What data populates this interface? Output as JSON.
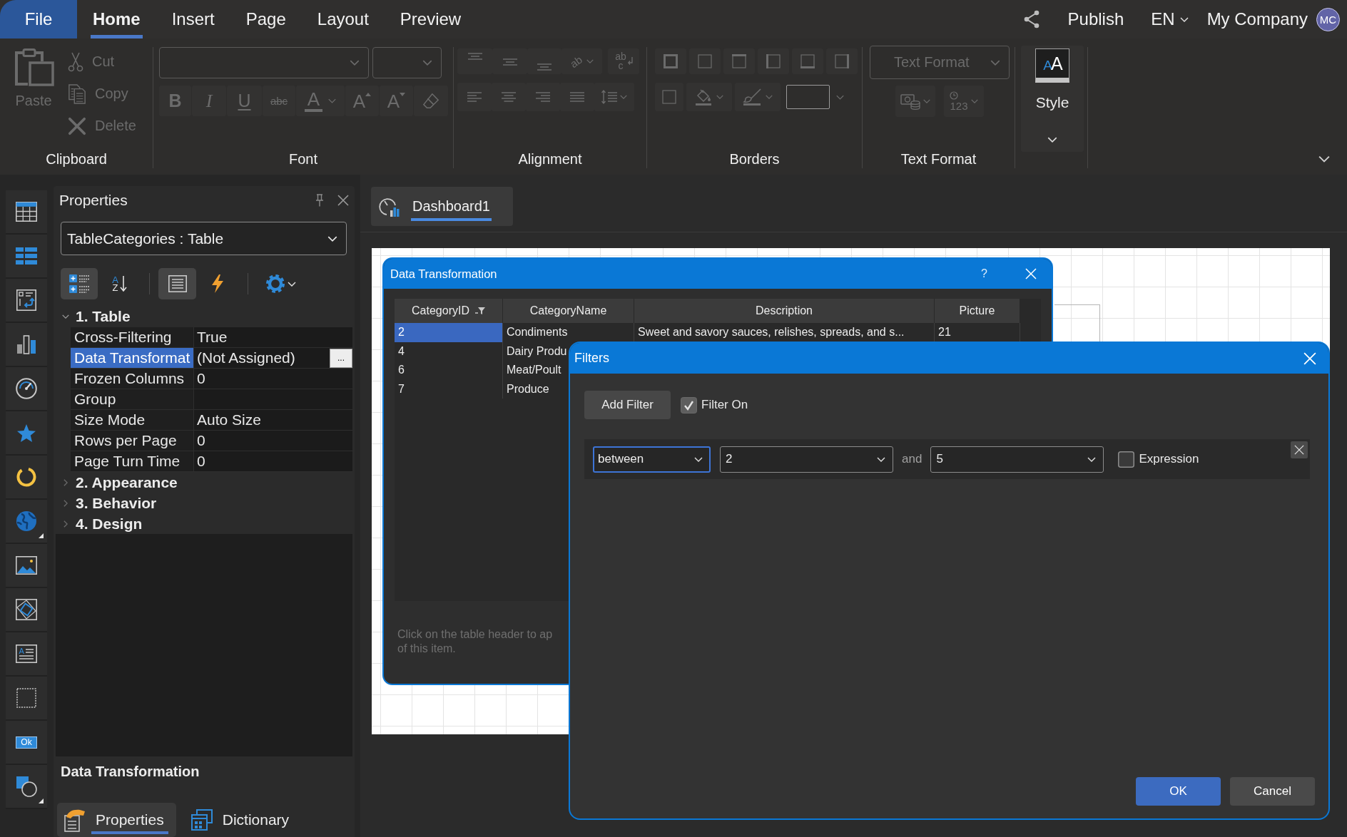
{
  "menu_bar": {
    "tabs": [
      {
        "label": "File",
        "kind": "backstage",
        "selected": false
      },
      {
        "label": "Home",
        "kind": "ribbon",
        "selected": true
      },
      {
        "label": "Insert",
        "kind": "ribbon",
        "selected": false
      },
      {
        "label": "Page",
        "kind": "ribbon",
        "selected": false
      },
      {
        "label": "Layout",
        "kind": "ribbon",
        "selected": false
      },
      {
        "label": "Preview",
        "kind": "ribbon",
        "selected": false
      }
    ],
    "publish": "Publish",
    "language": "EN",
    "account": "My Company",
    "avatar": "MC"
  },
  "ribbon": {
    "groups": [
      {
        "kind": "clipboard",
        "label": "Clipboard",
        "disabled": true,
        "paste": "Paste",
        "actions": [
          {
            "kind": "cut",
            "label": "Cut"
          },
          {
            "kind": "copy",
            "label": "Copy"
          },
          {
            "kind": "delete",
            "label": "Delete"
          }
        ]
      },
      {
        "kind": "font",
        "label": "Font",
        "disabled": true,
        "buttons": [
          {
            "kind": "bold",
            "glyph": "B"
          },
          {
            "kind": "italic",
            "glyph": "I"
          },
          {
            "kind": "underline",
            "glyph": "U"
          },
          {
            "kind": "strikeout",
            "glyph": "abc"
          },
          {
            "kind": "color",
            "glyph": "A"
          },
          {
            "kind": "grow",
            "glyph": "A"
          },
          {
            "kind": "shrink",
            "glyph": "A"
          },
          {
            "kind": "clear"
          }
        ]
      },
      {
        "kind": "alignment",
        "label": "Alignment",
        "disabled": true,
        "rotate_glyph": "ab",
        "wrap_glyph": "ab c"
      },
      {
        "kind": "borders",
        "label": "Borders",
        "disabled": true
      },
      {
        "kind": "text_format",
        "label": "Text Format",
        "disabled": true,
        "format_field": "Text Format",
        "number_glyph": "123"
      },
      {
        "kind": "style",
        "disabled": false,
        "button": "Style",
        "glyph": "AA"
      }
    ]
  },
  "components": [
    {
      "kind": "table",
      "submenu": false
    },
    {
      "kind": "cards",
      "submenu": false
    },
    {
      "kind": "pivot",
      "submenu": false
    },
    {
      "kind": "chart",
      "submenu": false
    },
    {
      "kind": "gauge",
      "submenu": false
    },
    {
      "kind": "indicator",
      "submenu": false
    },
    {
      "kind": "progress",
      "submenu": false
    },
    {
      "kind": "map",
      "submenu": true
    },
    {
      "kind": "image",
      "submenu": false
    },
    {
      "kind": "shape",
      "submenu": false
    },
    {
      "kind": "text",
      "glyph": "A",
      "submenu": false
    },
    {
      "kind": "panel",
      "submenu": false
    },
    {
      "kind": "button",
      "glyph": "Ok",
      "submenu": false
    },
    {
      "kind": "shapes",
      "submenu": true
    }
  ],
  "properties_panel": {
    "title": "Properties",
    "object": "TableCategories : Table",
    "toolbar": [
      {
        "kind": "categorized",
        "selected": true
      },
      {
        "kind": "alphabetical",
        "glyph": "AZ",
        "selected": false
      },
      {
        "kind": "properties",
        "selected": true
      },
      {
        "kind": "events",
        "selected": false
      },
      {
        "kind": "settings"
      }
    ],
    "categories": [
      {
        "label": "1. Table",
        "expanded": true,
        "properties": [
          {
            "name": "Cross-Filtering",
            "value": "True",
            "selected": false
          },
          {
            "name": "Data Transformat",
            "value": "(Not Assigned)",
            "selected": true,
            "editor_button": "..."
          },
          {
            "name": "Frozen Columns",
            "value": "0",
            "selected": false
          },
          {
            "name": "Group",
            "selected": false
          },
          {
            "name": "Size Mode",
            "value": "Auto Size",
            "selected": false
          },
          {
            "name": "Rows per Page",
            "value": "0",
            "selected": false
          },
          {
            "name": "Page Turn Time",
            "value": "0",
            "selected": false
          }
        ]
      },
      {
        "label": "2. Appearance",
        "expanded": false
      },
      {
        "label": "3. Behavior",
        "expanded": false
      },
      {
        "label": "4. Design",
        "expanded": false
      }
    ],
    "description": "Data Transformation",
    "tabs": [
      {
        "label": "Properties",
        "kind": "properties",
        "selected": true
      },
      {
        "label": "Dictionary",
        "kind": "dictionary",
        "selected": false
      }
    ]
  },
  "document": {
    "tabs": [
      {
        "label": "Dashboard1",
        "selected": true
      }
    ]
  },
  "data_transformation": {
    "title": "Data Transformation",
    "help": "?",
    "columns": [
      {
        "label": "CategoryID",
        "filtered": true
      },
      {
        "label": "CategoryName",
        "filtered": false
      },
      {
        "label": "Description",
        "filtered": false
      },
      {
        "label": "Picture",
        "filtered": false
      }
    ],
    "rows": [
      {
        "selected": true,
        "cells": [
          "2",
          "Condiments",
          "Sweet and savory sauces, relishes, spreads, and s...",
          "21"
        ]
      },
      {
        "selected": false,
        "cells": [
          "4",
          "Dairy Produ"
        ]
      },
      {
        "selected": false,
        "cells": [
          "6",
          "Meat/Poult"
        ]
      },
      {
        "selected": false,
        "cells": [
          "7",
          "Produce"
        ]
      }
    ],
    "hint": [
      "Click on the table header to ap",
      "of this item."
    ]
  },
  "filters": {
    "title": "Filters",
    "add_button": "Add Filter",
    "filter_on": {
      "label": "Filter On",
      "checked": true
    },
    "conditions": [
      {
        "operator": "between",
        "operator_focused": true,
        "value_1": "2",
        "conjunction": "and",
        "value_2": "5",
        "expression": {
          "label": "Expression",
          "checked": false
        }
      }
    ],
    "buttons": [
      {
        "kind": "primary",
        "label": "OK"
      },
      {
        "kind": "secondary",
        "label": "Cancel"
      }
    ]
  }
}
